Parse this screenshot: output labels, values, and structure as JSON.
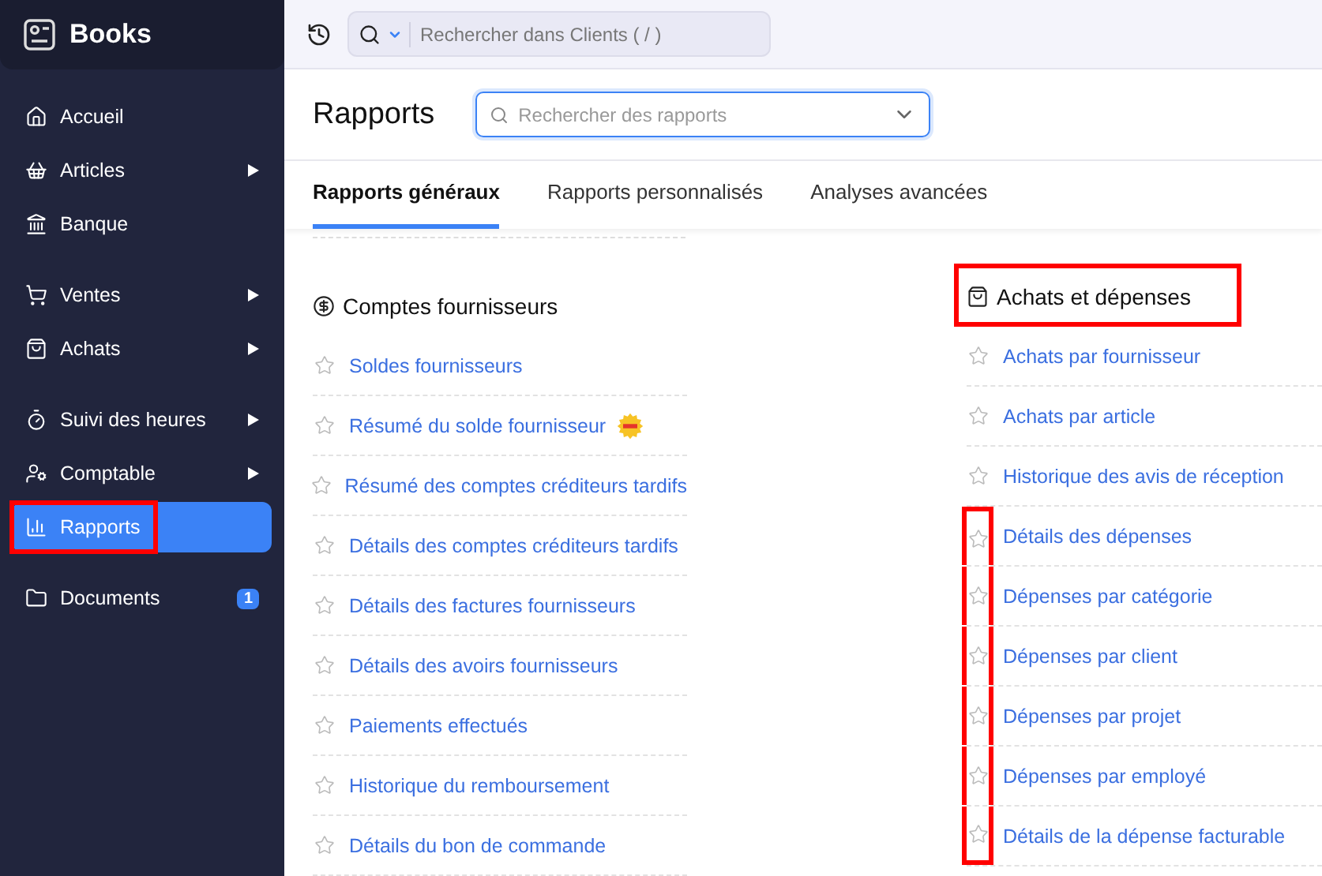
{
  "app": {
    "name": "Books"
  },
  "sidebar": {
    "groups": [
      {
        "items": [
          {
            "label": "Accueil",
            "has_submenu": false,
            "selected": false,
            "highlighted": false
          },
          {
            "label": "Articles",
            "has_submenu": true,
            "selected": false,
            "highlighted": false
          },
          {
            "label": "Banque",
            "has_submenu": false,
            "selected": false,
            "highlighted": false
          }
        ]
      },
      {
        "items": [
          {
            "label": "Ventes",
            "has_submenu": true,
            "selected": false,
            "highlighted": false
          },
          {
            "label": "Achats",
            "has_submenu": true,
            "selected": false,
            "highlighted": false
          }
        ]
      },
      {
        "items": [
          {
            "label": "Suivi des heures",
            "has_submenu": true,
            "selected": false,
            "highlighted": false
          },
          {
            "label": "Comptable",
            "has_submenu": true,
            "selected": false,
            "highlighted": false
          },
          {
            "label": "Rapports",
            "has_submenu": false,
            "selected": true,
            "highlighted": true
          }
        ]
      },
      {
        "items": [
          {
            "label": "Documents",
            "has_submenu": false,
            "selected": false,
            "highlighted": false,
            "badge": "1"
          }
        ]
      }
    ]
  },
  "top_bar": {
    "search": {
      "placeholder": "Rechercher dans Clients ( / )"
    }
  },
  "page": {
    "title": "Rapports",
    "search": {
      "placeholder": "Rechercher des rapports"
    }
  },
  "tabs": [
    {
      "label": "Rapports généraux",
      "selected": true
    },
    {
      "label": "Rapports personnalisés",
      "selected": false
    },
    {
      "label": "Analyses avancées",
      "selected": false
    }
  ],
  "sections": [
    {
      "title": "Comptes fournisseurs",
      "highlighted": false,
      "reports": [
        {
          "label": "Soldes fournisseurs",
          "new": false,
          "star_highlighted": false
        },
        {
          "label": "Résumé du solde fournisseur",
          "new": true,
          "star_highlighted": false
        },
        {
          "label": "Résumé des comptes créditeurs tardifs",
          "new": false,
          "star_highlighted": false
        },
        {
          "label": "Détails des comptes créditeurs tardifs",
          "new": false,
          "star_highlighted": false
        },
        {
          "label": "Détails des factures fournisseurs",
          "new": false,
          "star_highlighted": false
        },
        {
          "label": "Détails des avoirs fournisseurs",
          "new": false,
          "star_highlighted": false
        },
        {
          "label": "Paiements effectués",
          "new": false,
          "star_highlighted": false
        },
        {
          "label": "Historique du remboursement",
          "new": false,
          "star_highlighted": false
        },
        {
          "label": "Détails du bon de commande",
          "new": false,
          "star_highlighted": false
        }
      ]
    },
    {
      "title": "Achats et dépenses",
      "highlighted": true,
      "reports": [
        {
          "label": "Achats par fournisseur",
          "new": false,
          "star_highlighted": false
        },
        {
          "label": "Achats par article",
          "new": false,
          "star_highlighted": false
        },
        {
          "label": "Historique des avis de réception",
          "new": false,
          "star_highlighted": false
        },
        {
          "label": "Détails des dépenses",
          "new": false,
          "star_highlighted": true
        },
        {
          "label": "Dépenses par catégorie",
          "new": false,
          "star_highlighted": true
        },
        {
          "label": "Dépenses par client",
          "new": false,
          "star_highlighted": true
        },
        {
          "label": "Dépenses par projet",
          "new": false,
          "star_highlighted": true
        },
        {
          "label": "Dépenses par employé",
          "new": false,
          "star_highlighted": true
        },
        {
          "label": "Détails de la dépense facturable",
          "new": false,
          "star_highlighted": true
        }
      ]
    }
  ]
}
